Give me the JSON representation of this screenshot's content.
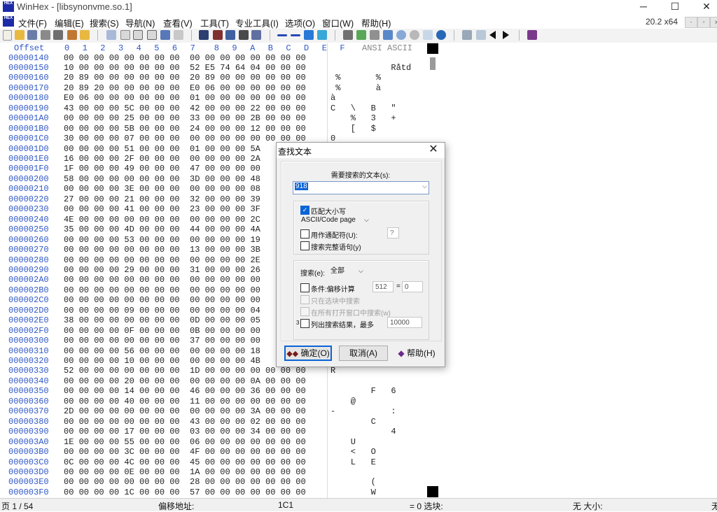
{
  "app": {
    "title": "WinHex - [libsynonvme.so.1]",
    "logo_text": "HEX",
    "version": "20.2 x64",
    "win_controls": [
      "─",
      "☐",
      "✕"
    ],
    "mdi_controls": [
      "-",
      "▫",
      "x"
    ]
  },
  "menu": {
    "items": [
      "文件(F)",
      "编辑(E)",
      "搜索(S)",
      "导航(N)",
      "查看(V)",
      "工具(T)",
      "专业工具(I)",
      "选项(O)",
      "窗口(W)",
      "帮助(H)"
    ]
  },
  "hex": {
    "header_offset": "Offset",
    "header_cols": "0  1  2  3  4  5  6  7   8  9  A  B  C  D  E  F",
    "header_ascii": "ANSI ASCII",
    "rows": [
      {
        "offset": "00000140",
        "hex": "00 00 00 00 00 00 00 00  00 00 00 00 00 00 00 00",
        "ascii": ""
      },
      {
        "offset": "00000150",
        "hex": "10 00 00 00 00 00 00 00  52 E5 74 64 04 00 00 00",
        "ascii": "            Råtd"
      },
      {
        "offset": "00000160",
        "hex": "20 89 00 00 00 00 00 00  20 89 00 00 00 00 00 00",
        "ascii": " %       %"
      },
      {
        "offset": "00000170",
        "hex": "20 89 20 00 00 00 00 00  E0 06 00 00 00 00 00 00",
        "ascii": " %       à"
      },
      {
        "offset": "00000180",
        "hex": "E0 06 00 00 00 00 00 00  01 00 00 00 00 00 00 00",
        "ascii": "à"
      },
      {
        "offset": "00000190",
        "hex": "43 00 00 00 5C 00 00 00  42 00 00 00 22 00 00 00",
        "ascii": "C   \\   B   \""
      },
      {
        "offset": "000001A0",
        "hex": "00 00 00 00 25 00 00 00  33 00 00 00 2B 00 00 00",
        "ascii": "    %   3   +"
      },
      {
        "offset": "000001B0",
        "hex": "00 00 00 00 5B 00 00 00  24 00 00 00 12 00 00 00",
        "ascii": "    [   $"
      },
      {
        "offset": "000001C0",
        "hex": "30 00 00 00 07 00 00 00  00 00 00 00 00 00 00 00",
        "ascii": "0"
      },
      {
        "offset": "000001D0",
        "hex": "00 00 00 00 51 00 00 00  01 00 00 00 5A",
        "ascii": ""
      },
      {
        "offset": "000001E0",
        "hex": "16 00 00 00 2F 00 00 00  00 00 00 00 2A",
        "ascii": ""
      },
      {
        "offset": "000001F0",
        "hex": "1F 00 00 00 49 00 00 00  47 00 00 00 00",
        "ascii": ""
      },
      {
        "offset": "00000200",
        "hex": "58 00 00 00 00 00 00 00  3D 00 00 00 48",
        "ascii": ""
      },
      {
        "offset": "00000210",
        "hex": "00 00 00 00 3E 00 00 00  00 00 00 00 08",
        "ascii": ""
      },
      {
        "offset": "00000220",
        "hex": "27 00 00 00 21 00 00 00  32 00 00 00 39",
        "ascii": ""
      },
      {
        "offset": "00000230",
        "hex": "00 00 00 00 41 00 00 00  23 00 00 00 3F",
        "ascii": ""
      },
      {
        "offset": "00000240",
        "hex": "4E 00 00 00 00 00 00 00  00 00 00 00 2C",
        "ascii": ""
      },
      {
        "offset": "00000250",
        "hex": "35 00 00 00 4D 00 00 00  44 00 00 00 4A",
        "ascii": ""
      },
      {
        "offset": "00000260",
        "hex": "00 00 00 00 53 00 00 00  00 00 00 00 19",
        "ascii": ""
      },
      {
        "offset": "00000270",
        "hex": "00 00 00 00 00 00 00 00  13 00 00 00 3B",
        "ascii": ""
      },
      {
        "offset": "00000280",
        "hex": "00 00 00 00 00 00 00 00  00 00 00 00 2E",
        "ascii": ""
      },
      {
        "offset": "00000290",
        "hex": "00 00 00 00 29 00 00 00  31 00 00 00 26",
        "ascii": ""
      },
      {
        "offset": "000002A0",
        "hex": "00 00 00 00 00 00 00 00  00 00 00 00 00",
        "ascii": ""
      },
      {
        "offset": "000002B0",
        "hex": "00 00 00 00 00 00 00 00  00 00 00 00 00",
        "ascii": ""
      },
      {
        "offset": "000002C0",
        "hex": "00 00 00 00 00 00 00 00  00 00 00 00 00",
        "ascii": ""
      },
      {
        "offset": "000002D0",
        "hex": "00 00 00 00 09 00 00 00  00 00 00 00 04",
        "ascii": ""
      },
      {
        "offset": "000002E0",
        "hex": "38 00 00 00 00 00 00 00  0D 00 00 00 05",
        "ascii": ""
      },
      {
        "offset": "000002F0",
        "hex": "00 00 00 00 0F 00 00 00  0B 00 00 00 00",
        "ascii": ""
      },
      {
        "offset": "00000300",
        "hex": "00 00 00 00 00 00 00 00  37 00 00 00 00",
        "ascii": ""
      },
      {
        "offset": "00000310",
        "hex": "00 00 00 00 56 00 00 00  00 00 00 00 18",
        "ascii": ""
      },
      {
        "offset": "00000320",
        "hex": "00 00 00 00 10 00 00 00  00 00 00 00 4B",
        "ascii": ""
      },
      {
        "offset": "00000330",
        "hex": "52 00 00 00 00 00 00 00  1D 00 00 00 00 00 00 00",
        "ascii": "R"
      },
      {
        "offset": "00000340",
        "hex": "00 00 00 00 20 00 00 00  00 00 00 00 0A 00 00 00",
        "ascii": ""
      },
      {
        "offset": "00000350",
        "hex": "00 00 00 00 14 00 00 00  46 00 00 00 36 00 00 00",
        "ascii": "        F   6"
      },
      {
        "offset": "00000360",
        "hex": "00 00 00 00 40 00 00 00  11 00 00 00 00 00 00 00",
        "ascii": "    @"
      },
      {
        "offset": "00000370",
        "hex": "2D 00 00 00 00 00 00 00  00 00 00 00 3A 00 00 00",
        "ascii": "-           :"
      },
      {
        "offset": "00000380",
        "hex": "00 00 00 00 00 00 00 00  43 00 00 00 02 00 00 00",
        "ascii": "        C"
      },
      {
        "offset": "00000390",
        "hex": "00 00 00 00 17 00 00 00  03 00 00 00 34 00 00 00",
        "ascii": "            4"
      },
      {
        "offset": "000003A0",
        "hex": "1E 00 00 00 55 00 00 00  06 00 00 00 00 00 00 00",
        "ascii": "    U"
      },
      {
        "offset": "000003B0",
        "hex": "00 00 00 00 3C 00 00 00  4F 00 00 00 00 00 00 00",
        "ascii": "    <   O"
      },
      {
        "offset": "000003C0",
        "hex": "0C 00 00 00 4C 00 00 00  45 00 00 00 00 00 00 00",
        "ascii": "    L   E"
      },
      {
        "offset": "000003D0",
        "hex": "00 00 00 00 0E 00 00 00  1A 00 00 00 00 00 00 00",
        "ascii": ""
      },
      {
        "offset": "000003E0",
        "hex": "00 00 00 00 00 00 00 00  28 00 00 00 00 00 00 00",
        "ascii": "        ("
      },
      {
        "offset": "000003F0",
        "hex": "00 00 00 00 1C 00 00 00  57 00 00 00 00 00 00 00",
        "ascii": "        W"
      }
    ]
  },
  "status": {
    "page": "页 1 / 54",
    "offset_label": "偏移地址:",
    "offset_value": "1C1",
    "eq": "= 0 选块:",
    "size": "无 大小:",
    "end": "无"
  },
  "dialog": {
    "title": "查找文本",
    "close": "✕",
    "search_label": "需要搜索的文本(s):",
    "search_value": "918",
    "match_case_label": "匹配大小写",
    "match_case_checked": true,
    "encoding": "ASCII/Code page",
    "wildcard_label": "用作通配符(U):",
    "wildcard_value": "?",
    "whole_word_label": "搜索完整语句(y)",
    "search_dir_label": "搜索(e):",
    "search_dir_value": "全部",
    "cond_label": "条件:偏移计算",
    "cond_mod": "512",
    "cond_eq": "=",
    "cond_val": "0",
    "only_block_label": "只在选块中搜索",
    "all_windows_label": "在所有打开窗口中搜索(w)",
    "list_prefix": "3",
    "list_label": "列出搜索结果，最多",
    "list_max": "10000",
    "ok_label": "确定(O)",
    "cancel_label": "取消(A)",
    "help_label": "帮助(H)"
  }
}
